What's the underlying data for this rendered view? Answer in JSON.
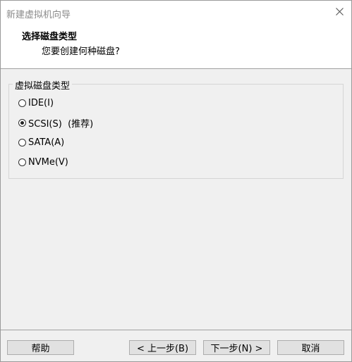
{
  "window": {
    "title": "新建虚拟机向导"
  },
  "header": {
    "title": "选择磁盘类型",
    "subtitle": "您要创建何种磁盘?"
  },
  "disk_type_group": {
    "legend": "虚拟磁盘类型",
    "options": [
      {
        "label": "IDE(I)",
        "checked": false
      },
      {
        "label": "SCSI(S)  (推荐)",
        "checked": true
      },
      {
        "label": "SATA(A)",
        "checked": false
      },
      {
        "label": "NVMe(V)",
        "checked": false
      }
    ]
  },
  "buttons": {
    "help": "帮助",
    "back": "< 上一步(B)",
    "next": "下一步(N) >",
    "cancel": "取消"
  },
  "icons": {
    "close": "close-icon"
  }
}
